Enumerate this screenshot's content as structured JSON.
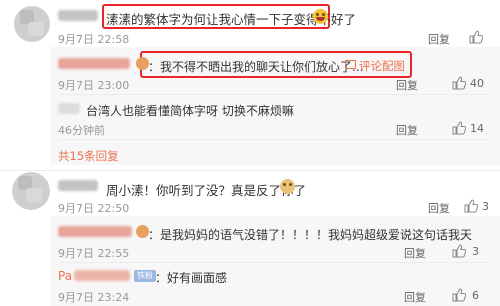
{
  "comment1": {
    "text": "溸溸的繁体字为何让我心情一下子变得不好了",
    "time": "9月7日 22:58",
    "reply_label": "回复",
    "replies": [
      {
        "text": "：我不得不晒出我的聊天让你们放心了...",
        "link": "评论配图",
        "time": "9月7日 23:00",
        "reply_label": "回复",
        "likes": "40"
      },
      {
        "text": "台湾人也能看懂简体字呀  切换不麻烦嘛",
        "time": "46分钟前",
        "reply_label": "回复",
        "likes": "14"
      }
    ],
    "more_replies": "共15条回复"
  },
  "comment2": {
    "text": "周小溸！你听到了没？真是反了你了",
    "time": "9月7日 22:50",
    "reply_label": "回复",
    "likes": "3",
    "replies": [
      {
        "text": "：是我妈妈的语气没错了！！！！我妈妈超级爱说这句话我天",
        "time": "9月7日 22:55",
        "reply_label": "回复",
        "likes": "3"
      },
      {
        "name_prefix": "Pa",
        "badge": "铁粉",
        "text": "：好有画面感",
        "time": "9月7日 23:24",
        "reply_label": "回复",
        "likes": "6"
      }
    ]
  },
  "icons": {
    "like": "thumb-up-icon",
    "image": "image-icon",
    "emoji_laugh": "laugh-emoji-icon",
    "emoji_dog": "dog-emoji-icon"
  },
  "colors": {
    "highlight_box": "#e8262a",
    "link": "#eb7350",
    "panel": "#f7f7f7"
  }
}
